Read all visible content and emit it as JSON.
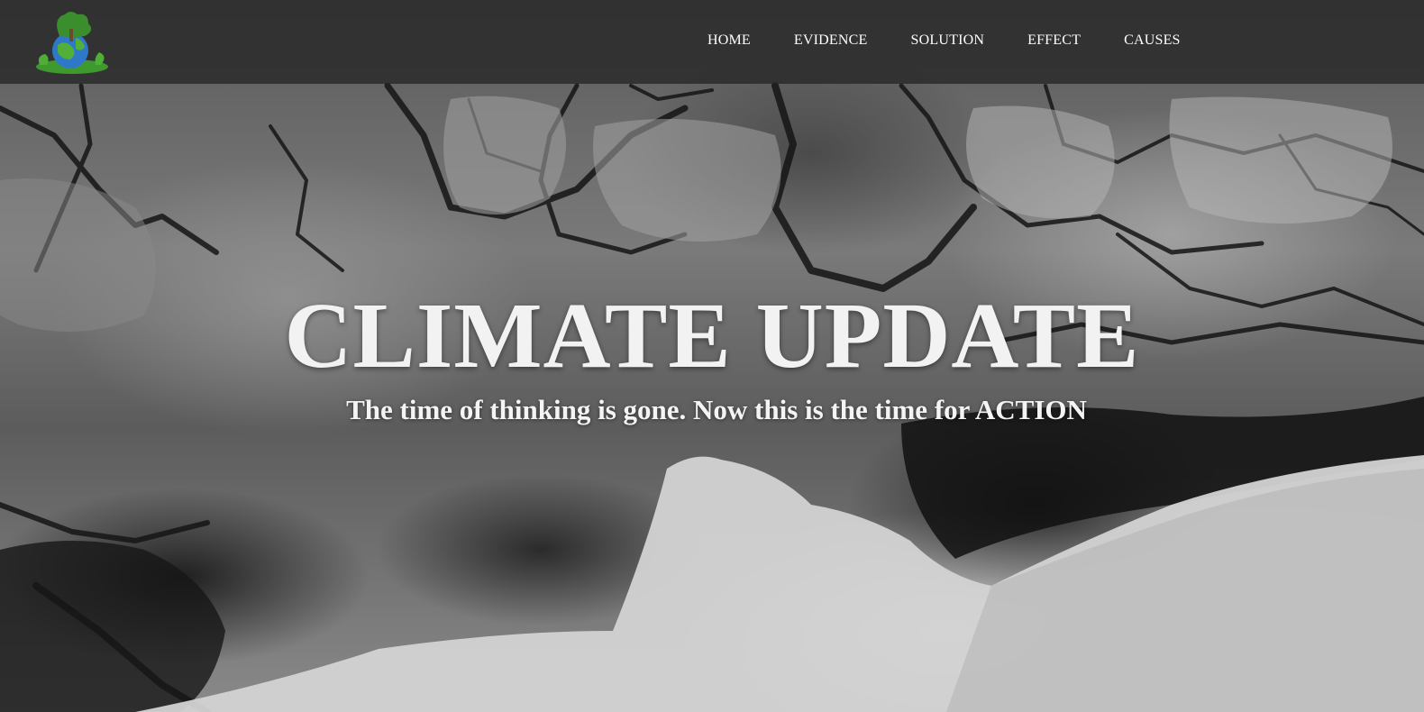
{
  "site": {
    "logo_icon": "globe-tree-icon"
  },
  "nav": {
    "items": [
      {
        "label": "HOME"
      },
      {
        "label": "EVIDENCE"
      },
      {
        "label": "SOLUTION"
      },
      {
        "label": "EFFECT"
      },
      {
        "label": "CAUSES"
      }
    ]
  },
  "hero": {
    "title": "CLIMATE UPDATE",
    "subtitle": "The time of thinking is gone. Now this is the time for ACTION",
    "background": "sea-ice-aerial-image"
  },
  "colors": {
    "navbar_bg": "#282828",
    "text": "#ffffff",
    "logo_green": "#3e9a2e",
    "logo_blue": "#2f78c8"
  }
}
